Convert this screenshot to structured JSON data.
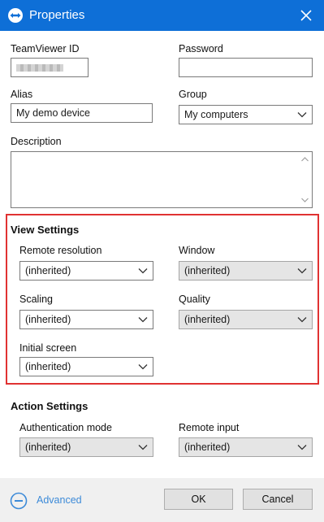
{
  "window": {
    "title": "Properties",
    "logo_icon": "teamviewer-logo-icon",
    "close_icon": "close-icon",
    "accent": "#0e6fd7"
  },
  "fields": {
    "teamviewer_id_label": "TeamViewer ID",
    "password_label": "Password",
    "password_value": "",
    "alias_label": "Alias",
    "alias_value": "My demo device",
    "group_label": "Group",
    "group_value": "My computers",
    "description_label": "Description",
    "description_value": ""
  },
  "view_settings": {
    "title": "View Settings",
    "highlight_color": "#e03232",
    "remote_resolution_label": "Remote resolution",
    "remote_resolution_value": "(inherited)",
    "window_label": "Window",
    "window_value": "(inherited)",
    "scaling_label": "Scaling",
    "scaling_value": "(inherited)",
    "quality_label": "Quality",
    "quality_value": "(inherited)",
    "initial_screen_label": "Initial screen",
    "initial_screen_value": "(inherited)"
  },
  "action_settings": {
    "title": "Action Settings",
    "authentication_mode_label": "Authentication mode",
    "authentication_mode_value": "(inherited)",
    "remote_input_label": "Remote input",
    "remote_input_value": "(inherited)"
  },
  "footer": {
    "advanced_label": "Advanced",
    "advanced_icon": "collapse-circle-icon",
    "ok_label": "OK",
    "cancel_label": "Cancel"
  }
}
